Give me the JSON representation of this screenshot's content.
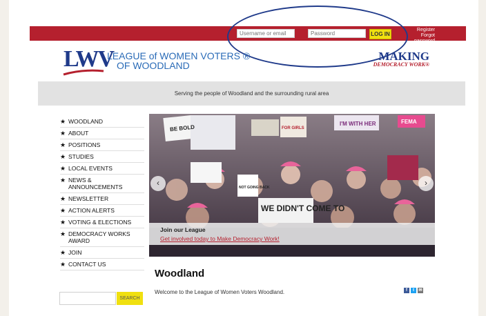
{
  "topbar": {
    "username_placeholder": "Username or email",
    "password_placeholder": "Password",
    "login_label": "LOG IN",
    "register_label": "Register",
    "forgot_label": "Forgot password"
  },
  "header": {
    "logo_text": "LWV",
    "org_line1": "LEAGUE of WOMEN VOTERS ®",
    "org_line2": "OF WOODLAND",
    "making_line1": "MAKING",
    "making_line2": "DEMOCRACY WORK®"
  },
  "tagline": "Serving the people of Woodland and the surrounding rural area",
  "sidebar": {
    "items": [
      {
        "label": "WOODLAND"
      },
      {
        "label": "ABOUT"
      },
      {
        "label": "POSITIONS"
      },
      {
        "label": "STUDIES"
      },
      {
        "label": "LOCAL EVENTS"
      },
      {
        "label": "NEWS & ANNOUNCEMENTS"
      },
      {
        "label": "NEWSLETTER"
      },
      {
        "label": "ACTION ALERTS"
      },
      {
        "label": "VOTING & ELECTIONS"
      },
      {
        "label": "DEMOCRACY WORKS AWARD"
      },
      {
        "label": "JOIN"
      },
      {
        "label": "CONTACT US"
      }
    ],
    "search_label": "SEARCH"
  },
  "hero": {
    "caption_title": "Join our League",
    "caption_link": "Get involved today to Make Democracy Work!",
    "sign_texts": [
      "I'M WITH HER",
      "WE DIDN'T COME TO",
      "NOT GOING BACK",
      "BE BOLD",
      "FOR GIRLS",
      "FEMA"
    ]
  },
  "content": {
    "title": "Woodland",
    "welcome": "Welcome to the League of Women Voters Woodland."
  },
  "colors": {
    "brand_red": "#b5202e",
    "brand_blue": "#1f3a8a",
    "accent_yellow": "#f0e010"
  }
}
